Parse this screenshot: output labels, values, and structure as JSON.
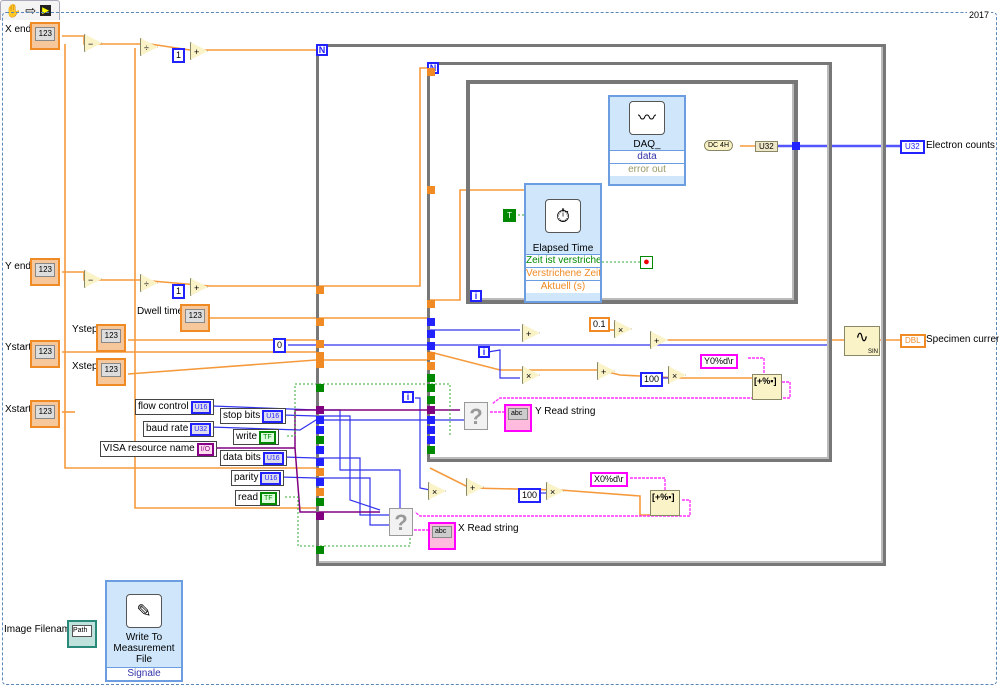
{
  "toolbar": {
    "icons": [
      "hand-icon",
      "arrow-icon",
      "vi-icon"
    ]
  },
  "diagram": {
    "version_label": "2017"
  },
  "loops": {
    "outer_count": "N",
    "inner_count": "N",
    "while_iteration": "i",
    "iteration_inner": "i",
    "iteration_outer": "i"
  },
  "controls": {
    "x_end": {
      "label": "X end",
      "value": "123",
      "type": "DBL"
    },
    "y_end": {
      "label": "Y end",
      "value": "123",
      "type": "DBL"
    },
    "ystart": {
      "label": "Ystart",
      "value": "123",
      "type": "DBL"
    },
    "xstart": {
      "label": "Xstart",
      "value": "123",
      "type": "DBL"
    },
    "ystep": {
      "label": "Ystep",
      "value": "123",
      "type": "DBL"
    },
    "xstep": {
      "label": "Xstep",
      "value": "123",
      "type": "DBL"
    },
    "dwell_time": {
      "label": "Dwell time",
      "value": "123",
      "type": "DBL"
    },
    "image_filename": {
      "label": "Image Filename",
      "value": "Path"
    }
  },
  "serial": [
    {
      "label": "flow control",
      "type": "U16"
    },
    {
      "label": "baud rate",
      "type": "U32"
    },
    {
      "label": "VISA resource name",
      "type": "I/O"
    },
    {
      "label": "stop bits",
      "type": "U16"
    },
    {
      "label": "write",
      "type": "TF"
    },
    {
      "label": "data bits",
      "type": "U16"
    },
    {
      "label": "parity",
      "type": "U16"
    },
    {
      "label": "read",
      "type": "TF"
    }
  ],
  "constants": {
    "one_a": "1",
    "one_b": "1",
    "zero": "0",
    "point_one": "0.1",
    "hundred_a": "100",
    "hundred_b": "100",
    "true_const": "T",
    "y_format": "Y0%d\\r",
    "x_format": "X0%d\\r"
  },
  "operators": {
    "subtract": "−",
    "divide": "÷",
    "add": "+",
    "multiply": "×"
  },
  "nodes": {
    "daq": {
      "title": "DAQ_",
      "terms": [
        "data",
        "error out"
      ]
    },
    "elapsed": {
      "title": "Elapsed Time",
      "terms": [
        "Zeit ist verstrichen",
        "Verstrichene Zeit",
        "Aktuell (s)"
      ]
    },
    "write_file": {
      "title": "Write To Measurement File",
      "terms": [
        "Signale"
      ]
    },
    "convert": "DC 4H",
    "u32": "U32",
    "sine": "SIN"
  },
  "indicators": {
    "electron_counts": {
      "label": "Electron counts",
      "type": "U32"
    },
    "specimen_current": {
      "label": "Specimen current",
      "type": "DBL"
    },
    "y_read_string": {
      "label": "Y Read string",
      "value": "abc"
    },
    "x_read_string": {
      "label": "X Read string",
      "value": "abc"
    }
  },
  "colors": {
    "double": "#f08a24",
    "integer": "#2222ff",
    "boolean": "#008000",
    "string": "#ff00ff",
    "visa": "#800080",
    "loop": "#777777"
  }
}
